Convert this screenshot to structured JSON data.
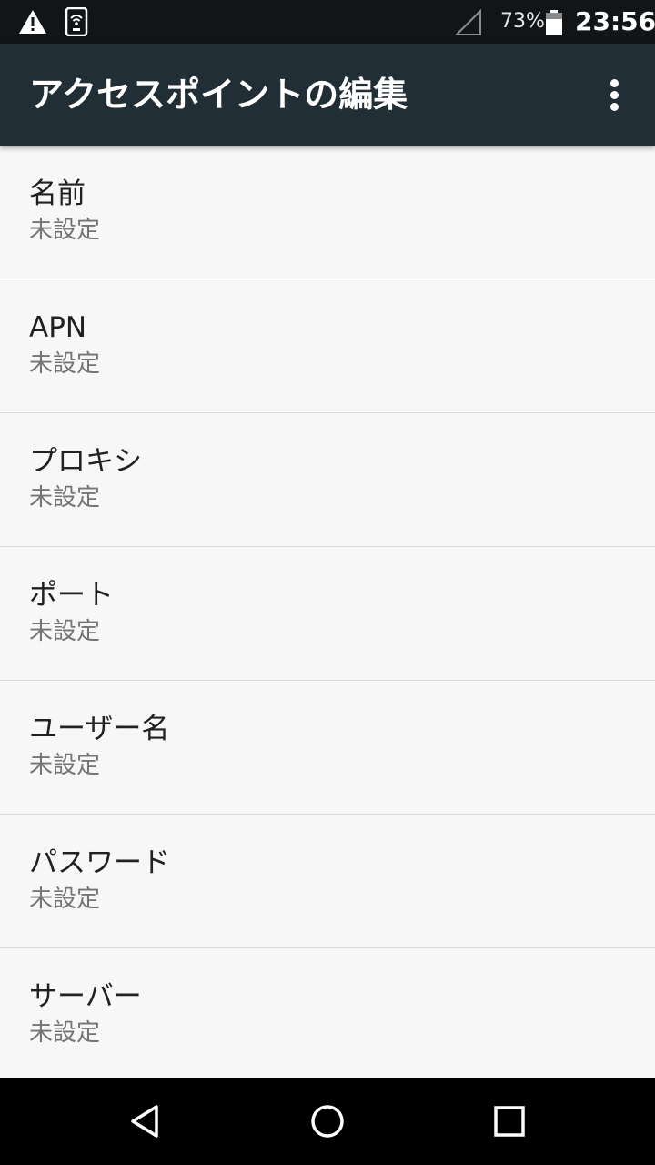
{
  "status_bar": {
    "battery_percent": "73%",
    "time": "23:56",
    "icons": [
      "warning-icon",
      "device-icon",
      "signal-icon",
      "battery-icon"
    ]
  },
  "app_bar": {
    "title": "アクセスポイントの編集",
    "menu_icon": "more-vert-icon"
  },
  "items": [
    {
      "title": "名前",
      "summary": "未設定"
    },
    {
      "title": "APN",
      "summary": "未設定"
    },
    {
      "title": "プロキシ",
      "summary": "未設定"
    },
    {
      "title": "ポート",
      "summary": "未設定"
    },
    {
      "title": "ユーザー名",
      "summary": "未設定"
    },
    {
      "title": "パスワード",
      "summary": "未設定"
    },
    {
      "title": "サーバー",
      "summary": "未設定"
    }
  ],
  "nav_bar": {
    "icons": [
      "back-icon",
      "home-icon",
      "recents-icon"
    ]
  },
  "colors": {
    "app_bar": "#212e35",
    "status_bar": "#111518",
    "background": "#f7f7f7",
    "title_text": "#212121",
    "summary_text": "#757575"
  }
}
